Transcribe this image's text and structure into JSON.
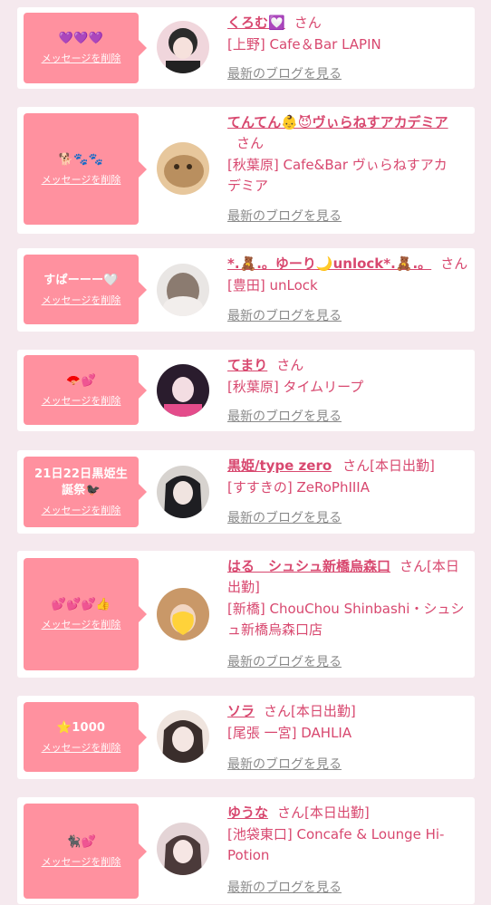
{
  "delete_label": "メッセージを削除",
  "blog_label": "最新のブログを見る",
  "cards": [
    {
      "message": "💜💜💜",
      "name": "くろむ💟",
      "suffix": "さん",
      "shop": "[上野] Cafe＆Bar LAPIN",
      "avatar_colors": [
        "#2b2b2b",
        "#f0d6dc"
      ]
    },
    {
      "message": "🐕🐾🐾",
      "name": "てんてん👶😈ヴぃらねすアカデミア",
      "suffix": "さん",
      "shop": "[秋葉原] Cafe&Bar ヴぃらねすアカデミア",
      "avatar_colors": [
        "#b98f5f",
        "#e7c79c"
      ]
    },
    {
      "message": "すぱーーー🤍",
      "name": "*.🧸.。ゆーり🌙unlock*.🧸.。",
      "suffix": "さん",
      "shop": "[豊田] unLock",
      "avatar_colors": [
        "#e9e6e4",
        "#8b7b70"
      ]
    },
    {
      "message": "🪭💕",
      "name": "てまり",
      "suffix": "さん",
      "shop": "[秋葉原] タイムリープ",
      "avatar_colors": [
        "#2a1c2d",
        "#e44c8b"
      ]
    },
    {
      "message": "21日22日黒姫生誕祭🐦‍⬛",
      "name": "黒姫/type zero",
      "suffix": "さん[本日出勤]",
      "shop": "[すすきの] ZeRoPhIIIA",
      "avatar_colors": [
        "#1e1e22",
        "#d7d3cf"
      ]
    },
    {
      "message": "💕💕💕👍",
      "name": "はる　シュシュ新橋烏森口",
      "suffix": "さん[本日出勤]",
      "shop": "[新橋] ChouChou Shinbashi・シュシュ新橋烏森口店",
      "avatar_colors": [
        "#c99868",
        "#ffd23a"
      ]
    },
    {
      "message": "⭐1000",
      "name": "ソラ",
      "suffix": "さん[本日出勤]",
      "shop": "[尾張 一宮] DAHLIA",
      "avatar_colors": [
        "#efe4de",
        "#3a2e2c"
      ]
    },
    {
      "message": "🐈‍⬛💕",
      "name": "ゆうな",
      "suffix": "さん[本日出勤]",
      "shop": "[池袋東口] Concafe & Lounge Hi-Potion",
      "avatar_colors": [
        "#e4d4d6",
        "#4b3a3a"
      ]
    }
  ]
}
